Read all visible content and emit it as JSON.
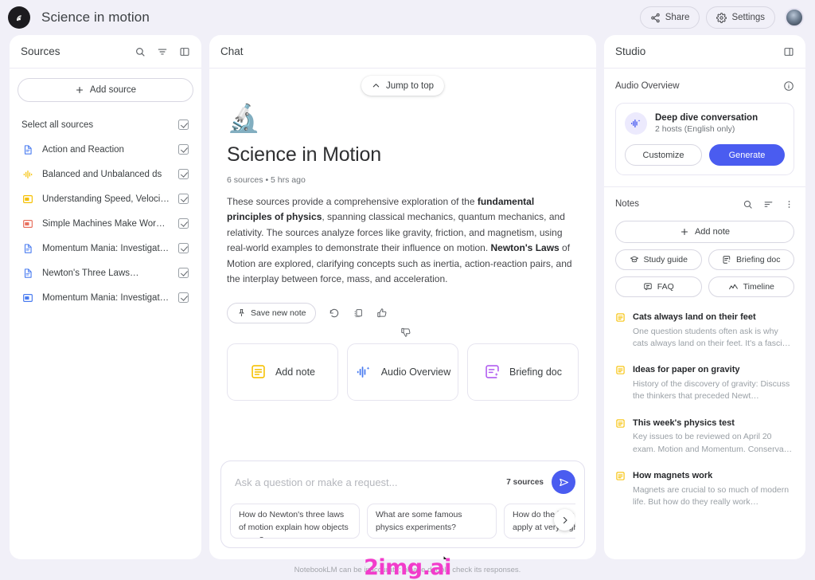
{
  "header": {
    "logo_icon": "notebooklm-logo-icon",
    "title": "Science in motion",
    "share_label": "Share",
    "share_icon": "share-icon",
    "settings_label": "Settings",
    "settings_icon": "gear-icon",
    "avatar_label": "account-avatar"
  },
  "sources": {
    "title": "Sources",
    "icons": [
      "search-icon",
      "filter-icon",
      "collapse-panel-icon"
    ],
    "add_source_label": "Add source",
    "select_all_label": "Select all sources",
    "items": [
      {
        "label": "Action and Reaction",
        "icon": "doc-blue-icon",
        "checked": true
      },
      {
        "label": "Balanced and Unbalanced ds",
        "icon": "audio-waveform-yellow-icon",
        "checked": true
      },
      {
        "label": "Understanding Speed, Velocity and…",
        "icon": "slide-yellow-icon",
        "checked": true
      },
      {
        "label": "Simple Machines Make Work Easier…",
        "icon": "slide-red-icon",
        "checked": true
      },
      {
        "label": "Momentum Mania: Investigating th…",
        "icon": "doc-blue-icon",
        "checked": true
      },
      {
        "label": "Newton's Three Laws…",
        "icon": "doc-blue-icon",
        "checked": true
      },
      {
        "label": "Momentum Mania: Investigating th…",
        "icon": "slide-blue-icon",
        "checked": true
      }
    ]
  },
  "chat": {
    "title": "Chat",
    "jump_to_top_label": "Jump to top",
    "doc_emoji": "🔬",
    "doc_title": "Science in Motion",
    "doc_meta": "6 sources • 5 hrs ago",
    "summary_part1": "These sources provide a comprehensive exploration of the ",
    "summary_bold1": "fundamental principles of physics",
    "summary_part2": ", spanning classical mechanics, quantum mechanics, and relativity. The sources analyze forces like gravity, friction, and magnetism, using real-world examples to demonstrate their influence on motion. ",
    "summary_bold2": "Newton's Laws",
    "summary_part3": " of Motion are explored, clarifying concepts such as inertia, action-reaction pairs, and the interplay between force, mass, and acceleration.",
    "save_note_label": "Save new note",
    "action_icons": [
      "refresh-icon",
      "copy-icon",
      "thumbs-up-icon",
      "thumbs-down-icon"
    ],
    "cards": [
      {
        "label": "Add note",
        "icon": "note-yellow-icon"
      },
      {
        "label": "Audio Overview",
        "icon": "audio-waveform-blue-icon"
      },
      {
        "label": "Briefing doc",
        "icon": "briefing-purple-icon"
      }
    ],
    "composer": {
      "placeholder": "Ask a question or make a request...",
      "value": "",
      "sources_count_label": "7 sources",
      "send_icon": "send-icon"
    },
    "suggestions": [
      "How do Newton's three laws of motion explain how objects move?",
      "What are some famous physics experiments?",
      "How do the laws of gravity apply at very high speeds or near…"
    ],
    "suggestions_next_icon": "chevron-right-icon"
  },
  "studio": {
    "title": "Studio",
    "collapse_icon": "collapse-panel-icon",
    "audio_overview": {
      "section_label": "Audio Overview",
      "info_icon": "info-icon",
      "card_icon": "audio-waveform-blue-icon",
      "name": "Deep dive conversation",
      "subtitle": "2 hosts (English only)",
      "customize_label": "Customize",
      "generate_label": "Generate"
    },
    "notes": {
      "section_label": "Notes",
      "icons": [
        "search-icon",
        "sort-icon",
        "more-vertical-icon"
      ],
      "add_note_label": "Add note",
      "chips": [
        {
          "label": "Study guide",
          "icon": "study-guide-icon"
        },
        {
          "label": "Briefing doc",
          "icon": "briefing-doc-icon"
        },
        {
          "label": "FAQ",
          "icon": "faq-icon"
        },
        {
          "label": "Timeline",
          "icon": "timeline-icon"
        }
      ],
      "items": [
        {
          "title": "Cats always land on their feet",
          "snippet": "One question students often ask is why cats always land on their feet. It's a fasci…",
          "icon": "note-yellow-icon"
        },
        {
          "title": "Ideas for paper on gravity",
          "snippet": "History of the discovery of gravity: Discuss the thinkers that preceded Newt…",
          "icon": "note-yellow-icon"
        },
        {
          "title": "This week's physics test",
          "snippet": "Key issues to be reviewed on April 20 exam. Motion and Momentum. Conserva…",
          "icon": "note-yellow-icon"
        },
        {
          "title": "How magnets work",
          "snippet": "Magnets are crucial to so much of modern life. But how do they really work…",
          "icon": "note-yellow-icon"
        }
      ]
    }
  },
  "footer": {
    "disclaimer": "NotebookLM can be inaccurate; please double check its responses.",
    "watermark": "2img.ai"
  },
  "colors": {
    "page_bg": "#f1f0f8",
    "panel_bg": "#ffffff",
    "accent": "#4a5cf0",
    "yellow": "#f6c000",
    "red": "#e8705f",
    "purple": "#b05cf0",
    "watermark": "#f23ccb"
  }
}
